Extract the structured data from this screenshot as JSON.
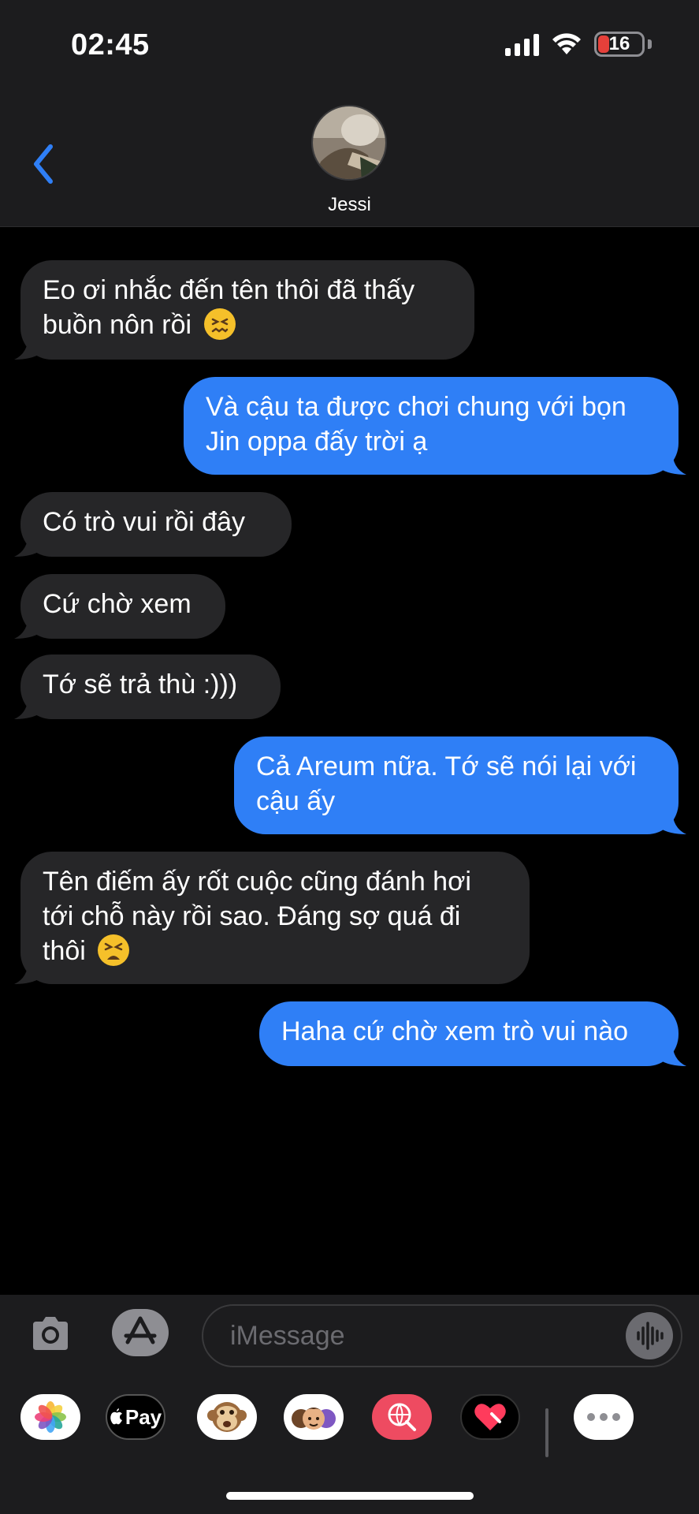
{
  "status_bar": {
    "time": "02:45",
    "battery": "16"
  },
  "header": {
    "contact_name": "Jessi"
  },
  "messages": [
    {
      "side": "in",
      "lines": [
        "Eo ơi nhắc đến tên thôi đã thấy",
        "buồn nôn rồi"
      ],
      "emoji": "confounded-face-emoji"
    },
    {
      "side": "out",
      "lines": [
        "Và cậu ta được chơi chung với bọn",
        "Jin oppa đấy trời ạ"
      ]
    },
    {
      "side": "in",
      "lines": [
        "Có trò vui rồi đây"
      ]
    },
    {
      "side": "in",
      "lines": [
        "Cứ chờ xem"
      ]
    },
    {
      "side": "in",
      "lines": [
        "Tớ sẽ trả thù :)))"
      ]
    },
    {
      "side": "out",
      "lines": [
        "Cả Areum nữa. Tớ sẽ nói lại với",
        "cậu ấy"
      ]
    },
    {
      "side": "in",
      "lines": [
        "Tên điếm ấy rốt cuộc cũng đánh hơi",
        "tới chỗ này rồi sao. Đáng sợ quá đi",
        "thôi"
      ],
      "emoji": "tired-face-emoji"
    },
    {
      "side": "out",
      "lines": [
        "Haha cứ chờ xem trò vui nào"
      ]
    }
  ],
  "input": {
    "placeholder": "iMessage"
  },
  "app_drawer": {
    "apple_pay_label": "Pay",
    "apps": [
      "photos-app",
      "apple-pay-app",
      "animoji-app",
      "memoji-app",
      "image-search-app",
      "digital-touch-app",
      "more-apps"
    ]
  },
  "colors": {
    "incoming_bubble": "#262628",
    "outgoing_bubble": "#2f7ff6",
    "accent": "#2f7ff6"
  }
}
